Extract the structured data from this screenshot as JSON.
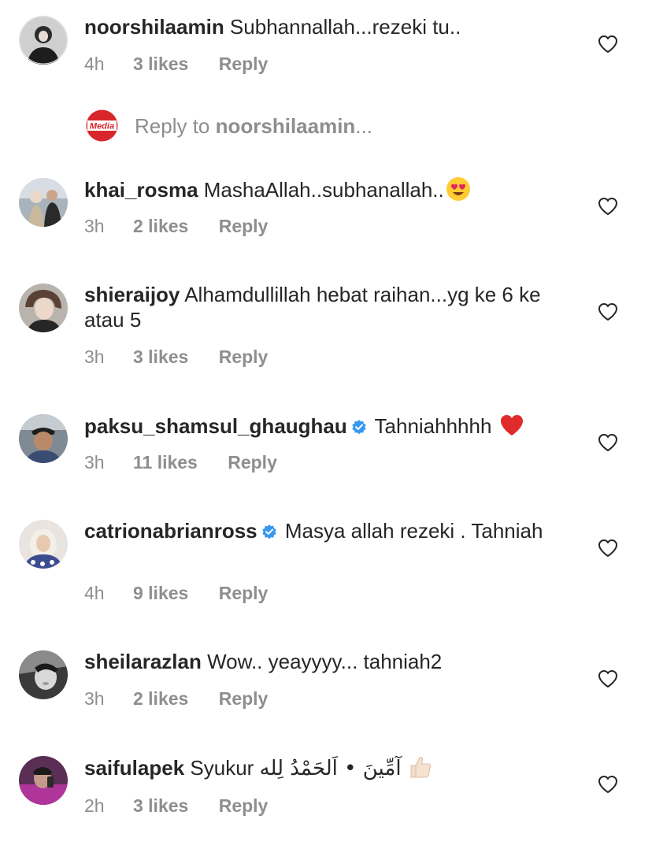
{
  "comments": [
    {
      "username": "noorshilaamin",
      "text": " Subhannallah...rezeki tu..",
      "time": "4h",
      "likes": "3 likes",
      "reply": "Reply",
      "verified": false
    },
    {
      "username": "khai_rosma",
      "text": " MashaAllah..subhanallah..",
      "emoji": "heart-eyes-emoji",
      "time": "3h",
      "likes": "2 likes",
      "reply": "Reply",
      "verified": false
    },
    {
      "username": "shieraijoy",
      "text": " Alhamdullillah hebat raihan...yg ke 6 ke atau 5",
      "time": "3h",
      "likes": "3 likes",
      "reply": "Reply",
      "verified": false
    },
    {
      "username": "paksu_shamsul_ghaughau",
      "text": " Tahniahhhhh ",
      "emoji": "red-heart-emoji",
      "time": "3h",
      "likes": "11 likes",
      "reply": "Reply",
      "verified": true
    },
    {
      "username": "catrionabrianross",
      "text": " Masya allah rezeki . Tahniah",
      "time": "4h",
      "likes": "9 likes",
      "reply": "Reply",
      "verified": true
    },
    {
      "username": "sheilarazlan",
      "text": " Wow.. yeayyyy... tahniah2",
      "time": "3h",
      "likes": "2 likes",
      "reply": "Reply",
      "verified": false
    },
    {
      "username": "saifulapek",
      "text": " Syukur ",
      "arabic": "آمِّينَ • اَلحَمْدُ لِله",
      "emoji": "thumbs-up-emoji",
      "time": "2h",
      "likes": "3 likes",
      "reply": "Reply",
      "verified": false
    }
  ],
  "reply_box": {
    "prefix": "Reply to ",
    "target": "noorshilaamin",
    "suffix": "...",
    "avatar_label": "Media"
  },
  "colors": {
    "text": "#262626",
    "secondary": "#8e8e8e",
    "verified": "#3897f0",
    "heart_red": "#e0245e",
    "media_red": "#d9262c"
  },
  "icons": {
    "like": "heart-outline-icon",
    "verified": "verified-badge-icon"
  }
}
